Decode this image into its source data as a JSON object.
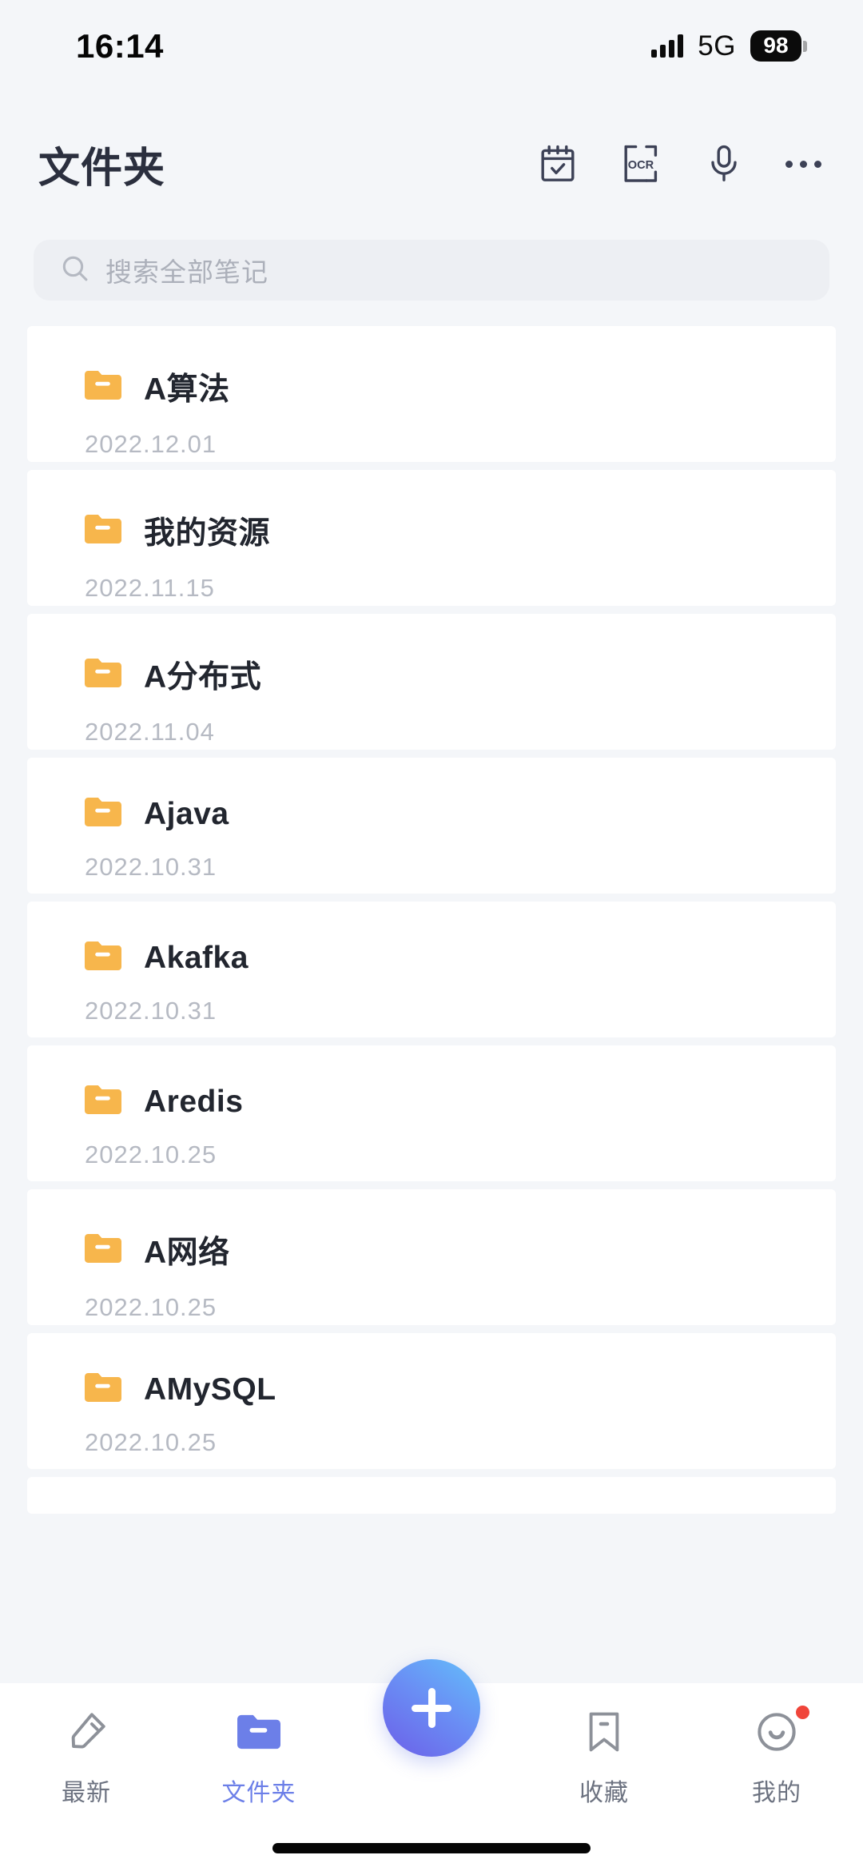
{
  "status_bar": {
    "time": "16:14",
    "network": "5G",
    "battery": "98",
    "signal_icon": "signal-bars-icon",
    "battery_icon": "battery-icon"
  },
  "header": {
    "title": "文件夹",
    "actions": [
      {
        "name": "calendar-check-icon",
        "label": "日历"
      },
      {
        "name": "ocr-icon",
        "label": "OCR"
      },
      {
        "name": "microphone-icon",
        "label": "语音"
      },
      {
        "name": "more-icon",
        "label": "更多"
      }
    ]
  },
  "search": {
    "placeholder": "搜索全部笔记",
    "icon": "search-icon",
    "value": ""
  },
  "folders": [
    {
      "name": "A算法",
      "date": "2022.12.01",
      "icon": "folder-icon"
    },
    {
      "name": "我的资源",
      "date": "2022.11.15",
      "icon": "folder-icon"
    },
    {
      "name": "A分布式",
      "date": "2022.11.04",
      "icon": "folder-icon"
    },
    {
      "name": "Ajava",
      "date": "2022.10.31",
      "icon": "folder-icon"
    },
    {
      "name": "Akafka",
      "date": "2022.10.31",
      "icon": "folder-icon"
    },
    {
      "name": "Aredis",
      "date": "2022.10.25",
      "icon": "folder-icon"
    },
    {
      "name": "A网络",
      "date": "2022.10.25",
      "icon": "folder-icon"
    },
    {
      "name": "AMySQL",
      "date": "2022.10.25",
      "icon": "folder-icon"
    }
  ],
  "tabbar": {
    "items": [
      {
        "label": "最新",
        "icon": "pen-icon",
        "active": false,
        "badge": false
      },
      {
        "label": "文件夹",
        "icon": "folder-icon",
        "active": true,
        "badge": false
      },
      {
        "label": "收藏",
        "icon": "bookmark-icon",
        "active": false,
        "badge": false
      },
      {
        "label": "我的",
        "icon": "smiley-icon",
        "active": false,
        "badge": true
      }
    ],
    "fab": {
      "name": "add-note-fab",
      "icon": "plus-icon"
    }
  },
  "colors": {
    "page_background": "#F4F6F9",
    "card_background": "#FFFFFF",
    "folder_icon": "#F7B64C",
    "accent": "#6C7FE8",
    "title_text": "#2B2F3E",
    "date_text": "#B6BAC3",
    "badge_red": "#F0453A"
  }
}
